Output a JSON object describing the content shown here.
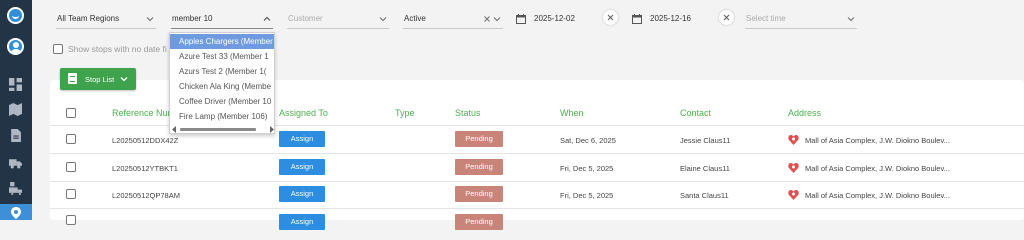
{
  "filters": {
    "region": "All Team Regions",
    "search_value": "member 10",
    "customer_placeholder": "Customer",
    "status": "Active",
    "date_from": "2025-12-02",
    "date_to": "2025-12-16",
    "time_placeholder": "Select time"
  },
  "show_stops_label": "Show stops with no date fi",
  "stop_list_label": "Stop List",
  "dropdown_items": [
    "Apples Chargers (Member",
    "Azure Test 33 (Member 1",
    "Azurs Test 2 (Member 1(",
    "Chicken Ala King (Membe",
    "Coffee Driver (Member 10",
    "Fire Lamp (Member 106)"
  ],
  "table": {
    "headers": [
      "Reference Nur",
      "Assigned To",
      "Type",
      "Status",
      "When",
      "Contact",
      "Address"
    ],
    "rows": [
      {
        "ref": "L20250512DDX42Z",
        "assign": "Assign",
        "status": "Pending",
        "when": "Sat, Dec 6, 2025",
        "contact": "Jessie Claus11",
        "address": "Mall of Asia Complex, J.W. Diokno Boulev..."
      },
      {
        "ref": "L20250512YTBKT1",
        "assign": "Assign",
        "status": "Pending",
        "when": "Fri, Dec 5, 2025",
        "contact": "Elaine Claus11",
        "address": "Mall of Asia Complex, J.W. Diokno Boulev..."
      },
      {
        "ref": "L20250512QP78AM",
        "assign": "Assign",
        "status": "Pending",
        "when": "Fri, Dec 5, 2025",
        "contact": "Santa Claus11",
        "address": "Mall of Asia Complex, J.W. Diokno Boulev..."
      },
      {
        "assign": "Assign",
        "status": "Pending"
      }
    ]
  },
  "colors": {
    "sidebar": "#243447",
    "accent_green": "#4caf50",
    "assign_blue": "#2d8de0",
    "pending": "#c9847a",
    "dropdown_selected": "#6e9be0"
  },
  "icons": [
    "app-logo-icon",
    "avatar-icon",
    "dashboard-icon",
    "map-icon",
    "document-icon",
    "truck-icon",
    "delivery-icon",
    "location-pin-icon",
    "calendar-icon",
    "close-icon",
    "chevron-down-icon",
    "chevron-up-icon",
    "address-pin-icon"
  ]
}
